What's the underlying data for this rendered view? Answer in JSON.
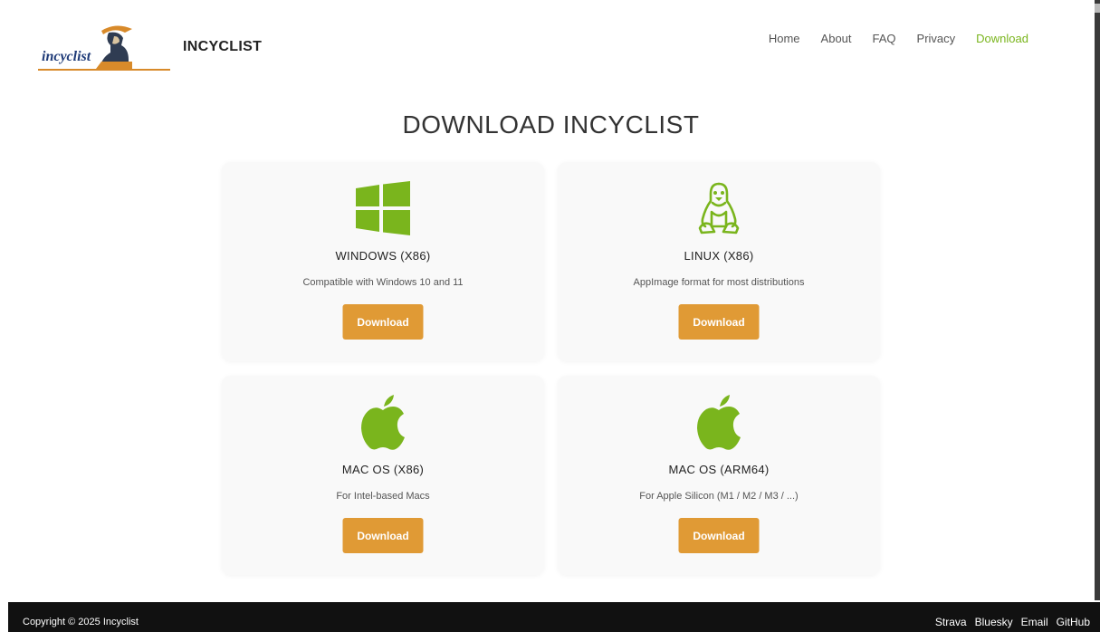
{
  "header": {
    "logo_text": "incyclist",
    "brand": "INCYCLIST",
    "nav": [
      {
        "label": "Home",
        "active": false
      },
      {
        "label": "About",
        "active": false
      },
      {
        "label": "FAQ",
        "active": false
      },
      {
        "label": "Privacy",
        "active": false
      },
      {
        "label": "Download",
        "active": true
      }
    ]
  },
  "main": {
    "title": "DOWNLOAD INCYCLIST",
    "cards": [
      {
        "icon": "windows-icon",
        "title": "WINDOWS (X86)",
        "description": "Compatible with Windows 10 and 11",
        "button_label": "Download"
      },
      {
        "icon": "linux-icon",
        "title": "LINUX (X86)",
        "description": "AppImage format for most distributions",
        "button_label": "Download"
      },
      {
        "icon": "apple-icon",
        "title": "MAC OS (X86)",
        "description": "For Intel-based Macs",
        "button_label": "Download"
      },
      {
        "icon": "apple-icon",
        "title": "MAC OS (ARM64)",
        "description": "For Apple Silicon (M1 / M2 / M3 / ...)",
        "button_label": "Download"
      }
    ]
  },
  "footer": {
    "copyright": "Copyright © 2025 Incyclist",
    "links": [
      "Strava",
      "Bluesky",
      "Email",
      "GitHub"
    ]
  },
  "colors": {
    "accent_green": "#7ab51d",
    "button_orange": "#e09a35",
    "logo_blue": "#1f3b78",
    "footer_bg": "#111111"
  }
}
